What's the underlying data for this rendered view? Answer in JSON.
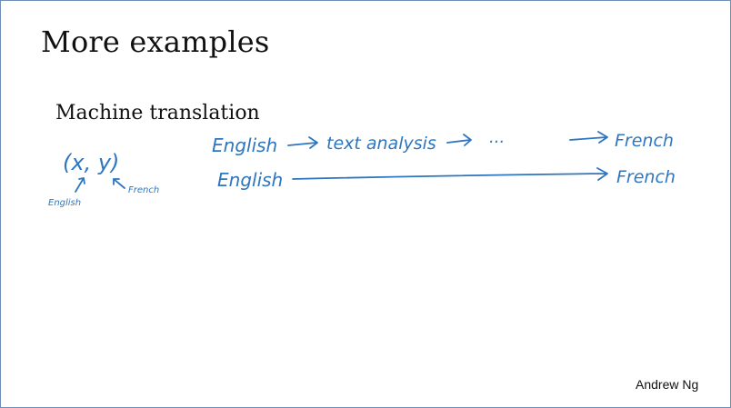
{
  "slide": {
    "title": "More examples",
    "subtitle": "Machine translation",
    "author": "Andrew Ng"
  },
  "ink": {
    "pair": "(x, y)",
    "pair_x_note": "English",
    "pair_y_note": "French",
    "row1_source": "English",
    "row1_mid": "text analysis",
    "row1_ellipsis": "...",
    "row1_target": "French",
    "row2_source": "English",
    "row2_target": "French",
    "color": "#2e76bf"
  }
}
